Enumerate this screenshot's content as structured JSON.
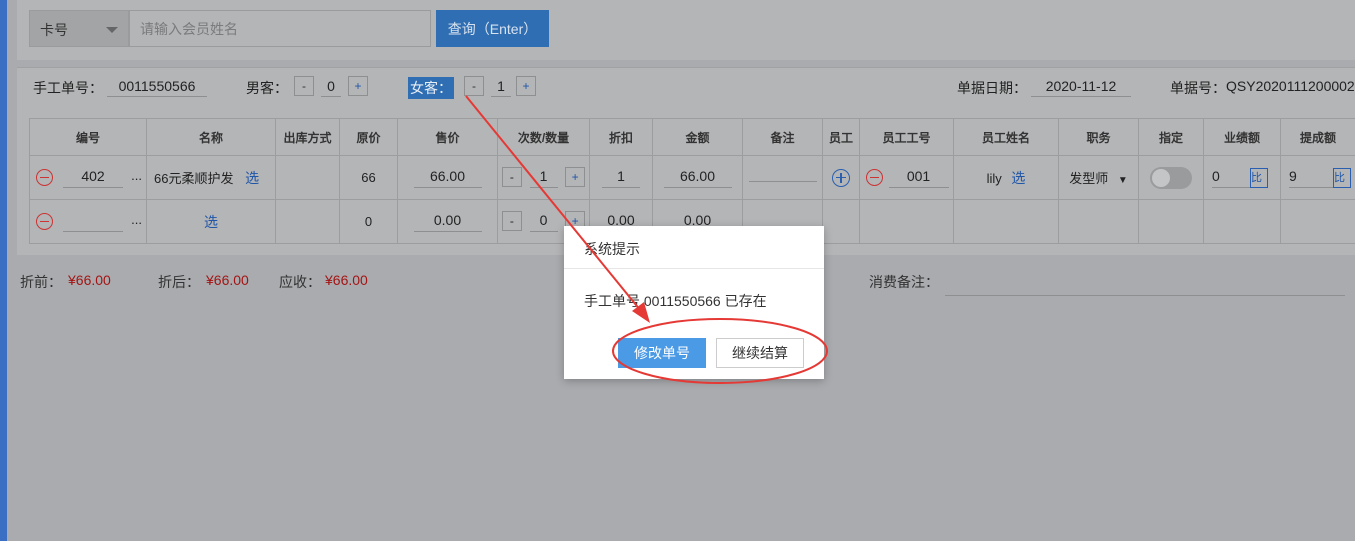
{
  "search": {
    "card_type": "卡号",
    "member_placeholder": "请输入会员姓名",
    "query_label": "查询（Enter）"
  },
  "order": {
    "manual_no_label": "手工单号：",
    "manual_no": "0011550566",
    "male_label": "男客：",
    "male_count": "0",
    "female_label": "女客：",
    "female_count": "1",
    "date_label": "单据日期：",
    "date": "2020-11-12",
    "doc_no_label": "单据号：",
    "doc_no": "QSY2020111200002",
    "minus": "-",
    "plus": "+"
  },
  "table": {
    "headers": [
      "编号",
      "名称",
      "出库方式",
      "原价",
      "售价",
      "次数/数量",
      "折扣",
      "金额",
      "备注",
      "员工",
      "员工工号",
      "员工姓名",
      "职务",
      "指定",
      "业绩额",
      "提成额"
    ],
    "rows": [
      {
        "code": "402",
        "more": "...",
        "name": "66元柔顺护发",
        "select": "选",
        "original": "66",
        "price": "66.00",
        "qty": "1",
        "discount": "1",
        "amount": "66.00",
        "emp_no": "001",
        "emp_name": "lily",
        "emp_select": "选",
        "role": "发型师",
        "perf": "0",
        "perf_btn": "比",
        "commission": "9",
        "comm_btn": "比"
      },
      {
        "code": "",
        "more": "...",
        "name": "",
        "select": "选",
        "original": "0",
        "price": "0.00",
        "qty": "0",
        "discount": "0.00",
        "amount": "0.00"
      }
    ]
  },
  "summary": {
    "before_label": "折前：",
    "before": "¥66.00",
    "after_label": "折后：",
    "after": "¥66.00",
    "due_label": "应收：",
    "due": "¥66.00",
    "remark_label": "消费备注："
  },
  "dialog": {
    "title": "系统提示",
    "message": "手工单号 0011550566 已存在",
    "modify_label": "修改单号",
    "continue_label": "继续结算"
  },
  "colors": {
    "accent": "#2f6eb3",
    "annotation": "#e53935",
    "price_red": "#a31515"
  }
}
